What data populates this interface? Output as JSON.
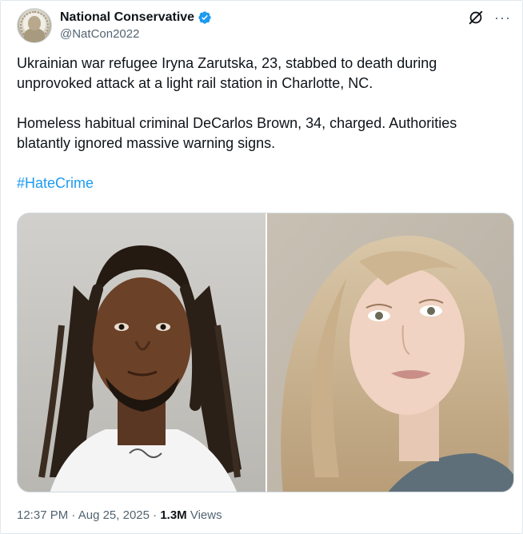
{
  "author": {
    "display_name": "National Conservative",
    "handle": "@NatCon2022",
    "verified_color": "#1d9bf0",
    "avatar_icon": "statue-avatar"
  },
  "header": {
    "grok_icon": "grok-icon",
    "more_label": "···"
  },
  "tweet": {
    "paragraph_1": "Ukrainian war refugee Iryna Zarutska, 23, stabbed to death during unprovoked attack at a light rail station in Charlotte, NC.",
    "paragraph_2": "Homeless habitual criminal DeCarlos Brown, 34, charged. Authorities blatantly ignored massive warning signs.",
    "hashtag": "#HateCrime"
  },
  "media": {
    "photo_left": "mugshot-photo",
    "photo_right": "portrait-photo"
  },
  "footer": {
    "time": "12:37 PM",
    "separator_1": " · ",
    "date": "Aug 25, 2025",
    "separator_2": " · ",
    "views_count": "1.3M",
    "views_label": " Views"
  },
  "colors": {
    "text": "#0f1419",
    "secondary": "#536471",
    "link": "#1d9bf0",
    "border": "#cfd9de"
  }
}
